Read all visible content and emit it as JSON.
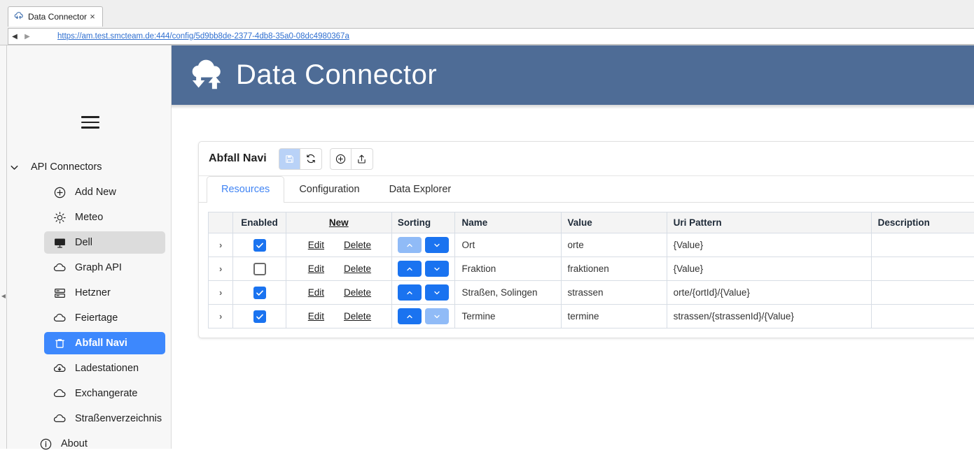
{
  "browser": {
    "tab": {
      "title": "Data Connector",
      "favicon_icon": "cloud-transfer-icon",
      "close_icon": "close-icon",
      "close_label": "×"
    },
    "nav": {
      "back_label": "◀",
      "forward_label": "▶",
      "back_icon": "back-arrow-icon",
      "forward_icon": "forward-arrow-icon"
    },
    "url": "https://am.test.smcteam.de:444/config/5d9bb8de-2377-4db8-35a0-08dc4980367a"
  },
  "sidebar": {
    "menu_icon": "hamburger-menu-icon",
    "collapse_icon": "collapse-left-icon",
    "collapse_label": "◀",
    "group": {
      "label": "API Connectors",
      "chevron_icon": "chevron-down-icon",
      "expanded": true
    },
    "items": [
      {
        "label": "Add New",
        "icon": "plus-circle-icon",
        "state": "normal"
      },
      {
        "label": "Meteo",
        "icon": "sun-icon",
        "state": "normal"
      },
      {
        "label": "Dell",
        "icon": "monitor-icon",
        "state": "selected"
      },
      {
        "label": "Graph API",
        "icon": "cloud-icon",
        "state": "normal"
      },
      {
        "label": "Hetzner",
        "icon": "server-icon",
        "state": "normal"
      },
      {
        "label": "Feiertage",
        "icon": "cloud-icon",
        "state": "normal"
      },
      {
        "label": "Abfall Navi",
        "icon": "trash-icon",
        "state": "active"
      },
      {
        "label": "Ladestationen",
        "icon": "cloud-download-icon",
        "state": "normal"
      },
      {
        "label": "Exchangerate",
        "icon": "cloud-icon",
        "state": "normal"
      },
      {
        "label": "Straßenverzeichnis",
        "icon": "cloud-icon",
        "state": "normal"
      }
    ],
    "about": {
      "label": "About",
      "icon": "info-circle-icon"
    }
  },
  "header": {
    "title": "Data Connector",
    "logo_icon": "cloud-transfer-icon",
    "background_color": "#4e6c96"
  },
  "card": {
    "title": "Abfall Navi",
    "toolbar_buttons": [
      {
        "name": "save-button",
        "icon": "floppy-disk-icon",
        "highlight": true
      },
      {
        "name": "refresh-button",
        "icon": "refresh-icon",
        "highlight": false
      },
      {
        "name": "add-button",
        "icon": "plus-circle-icon",
        "highlight": false
      },
      {
        "name": "export-button",
        "icon": "upload-share-icon",
        "highlight": false
      }
    ],
    "tabs": [
      {
        "label": "Resources",
        "active": true
      },
      {
        "label": "Configuration",
        "active": false
      },
      {
        "label": "Data Explorer",
        "active": false
      }
    ],
    "active_tab_color": "#4285f4"
  },
  "table": {
    "headers": {
      "expand": "",
      "enabled": "Enabled",
      "actions": "New",
      "sorting": "Sorting",
      "name": "Name",
      "value": "Value",
      "uri_pattern": "Uri Pattern",
      "description": "Description"
    },
    "actions_header_is_link": true,
    "row_actions": {
      "edit": "Edit",
      "delete": "Delete"
    },
    "sort_icons": {
      "up": "chevron-up-icon",
      "down": "chevron-down-icon"
    },
    "expand_icon": "chevron-right-icon",
    "expand_label": "›",
    "rows": [
      {
        "expand": "›",
        "enabled": true,
        "edit": "Edit",
        "delete": "Delete",
        "sort_up_disabled": true,
        "sort_down_disabled": false,
        "name": "Ort",
        "value": "orte",
        "uri_pattern": "{Value}",
        "description": ""
      },
      {
        "expand": "›",
        "enabled": false,
        "edit": "Edit",
        "delete": "Delete",
        "sort_up_disabled": false,
        "sort_down_disabled": false,
        "name": "Fraktion",
        "value": "fraktionen",
        "uri_pattern": "{Value}",
        "description": ""
      },
      {
        "expand": "›",
        "enabled": true,
        "edit": "Edit",
        "delete": "Delete",
        "sort_up_disabled": false,
        "sort_down_disabled": false,
        "name": "Straßen, Solingen",
        "value": "strassen",
        "uri_pattern": "orte/{ortId}/{Value}",
        "description": ""
      },
      {
        "expand": "›",
        "enabled": true,
        "edit": "Edit",
        "delete": "Delete",
        "sort_up_disabled": false,
        "sort_down_disabled": true,
        "name": "Termine",
        "value": "termine",
        "uri_pattern": "strassen/{strassenId}/{Value}",
        "description": ""
      }
    ]
  },
  "colors": {
    "accent_blue": "#1a73f0",
    "accent_blue_disabled": "#90bbf7",
    "header_blue": "#4e6c96",
    "link_blue": "#2f6fd0",
    "sidebar_active": "#3d88fd"
  }
}
